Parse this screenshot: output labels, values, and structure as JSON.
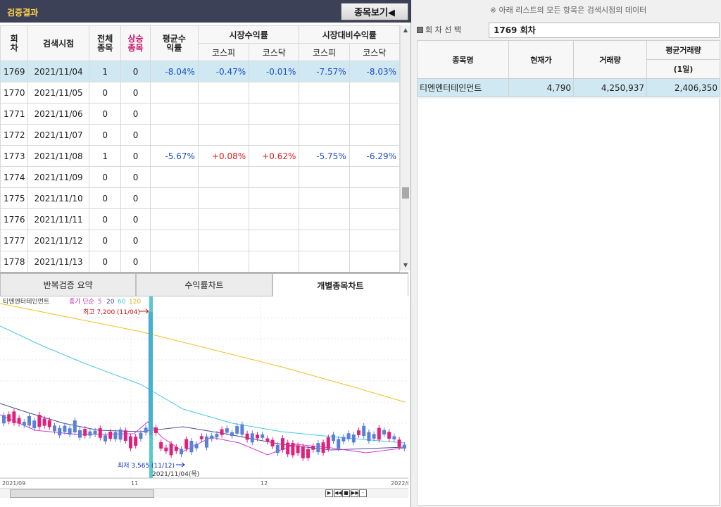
{
  "title": "검증결과",
  "stock_view_button": "종목보기◀",
  "table": {
    "headers": {
      "round": "회차",
      "date": "검색시점",
      "total": "전체종목",
      "rise": "상승종목",
      "avg": "평균수익률",
      "market": "시장수익률",
      "relative": "시장대비수익률",
      "kospi": "코스피",
      "kosdaq": "코스닥"
    },
    "rows": [
      {
        "round": "1769",
        "date": "2021/11/04",
        "total": "1",
        "rise": "0",
        "avg": "-8.04%",
        "m_kospi": "-0.47%",
        "m_kosdaq": "-0.01%",
        "r_kospi": "-7.57%",
        "r_kosdaq": "-8.03%"
      },
      {
        "round": "1770",
        "date": "2021/11/05",
        "total": "0",
        "rise": "0",
        "avg": "",
        "m_kospi": "",
        "m_kosdaq": "",
        "r_kospi": "",
        "r_kosdaq": ""
      },
      {
        "round": "1771",
        "date": "2021/11/06",
        "total": "0",
        "rise": "0",
        "avg": "",
        "m_kospi": "",
        "m_kosdaq": "",
        "r_kospi": "",
        "r_kosdaq": ""
      },
      {
        "round": "1772",
        "date": "2021/11/07",
        "total": "0",
        "rise": "0",
        "avg": "",
        "m_kospi": "",
        "m_kosdaq": "",
        "r_kospi": "",
        "r_kosdaq": ""
      },
      {
        "round": "1773",
        "date": "2021/11/08",
        "total": "1",
        "rise": "0",
        "avg": "-5.67%",
        "m_kospi": "+0.08%",
        "m_kosdaq": "+0.62%",
        "r_kospi": "-5.75%",
        "r_kosdaq": "-6.29%"
      },
      {
        "round": "1774",
        "date": "2021/11/09",
        "total": "0",
        "rise": "0",
        "avg": "",
        "m_kospi": "",
        "m_kosdaq": "",
        "r_kospi": "",
        "r_kosdaq": ""
      },
      {
        "round": "1775",
        "date": "2021/11/10",
        "total": "0",
        "rise": "0",
        "avg": "",
        "m_kospi": "",
        "m_kosdaq": "",
        "r_kospi": "",
        "r_kosdaq": ""
      },
      {
        "round": "1776",
        "date": "2021/11/11",
        "total": "0",
        "rise": "0",
        "avg": "",
        "m_kospi": "",
        "m_kosdaq": "",
        "r_kospi": "",
        "r_kosdaq": ""
      },
      {
        "round": "1777",
        "date": "2021/11/12",
        "total": "0",
        "rise": "0",
        "avg": "",
        "m_kospi": "",
        "m_kosdaq": "",
        "r_kospi": "",
        "r_kosdaq": ""
      },
      {
        "round": "1778",
        "date": "2021/11/13",
        "total": "0",
        "rise": "0",
        "avg": "",
        "m_kospi": "",
        "m_kosdaq": "",
        "r_kospi": "",
        "r_kosdaq": ""
      }
    ]
  },
  "tabs": [
    "반복검증 요약",
    "수익률차트",
    "개별종목차트"
  ],
  "chart": {
    "stock_name": "티엔엔터테인먼트",
    "legend_label": "종가 단순",
    "ma": [
      "5",
      "20",
      "60",
      "120"
    ],
    "ma_colors": [
      "#d03ad0",
      "#4a4a9a",
      "#44c8e8",
      "#f0c020"
    ],
    "high_label": "최고 7,200 (11/04)",
    "low_label": "최저 3,565 (11/12)",
    "cursor_date": "2021/11/04(목)",
    "x_labels": [
      "2021/09",
      "11",
      "12",
      "2022/0"
    ],
    "up_color": "#e0207a",
    "down_color": "#5a80d8"
  },
  "right": {
    "notice": "※ 아래 리스트의 모든 항목은 검색시점의 데이터",
    "round_label": "회 차 선 택",
    "round_value": "1769 회차",
    "headers": {
      "name": "종목명",
      "price": "현재가",
      "volume": "거래량",
      "avg_volume": "평균거래량",
      "avg_volume_sub": "(1일)"
    },
    "rows": [
      {
        "name": "티엔엔터테인먼트",
        "price": "4,790",
        "volume": "4,250,937",
        "avg_volume": "2,406,350"
      }
    ]
  }
}
